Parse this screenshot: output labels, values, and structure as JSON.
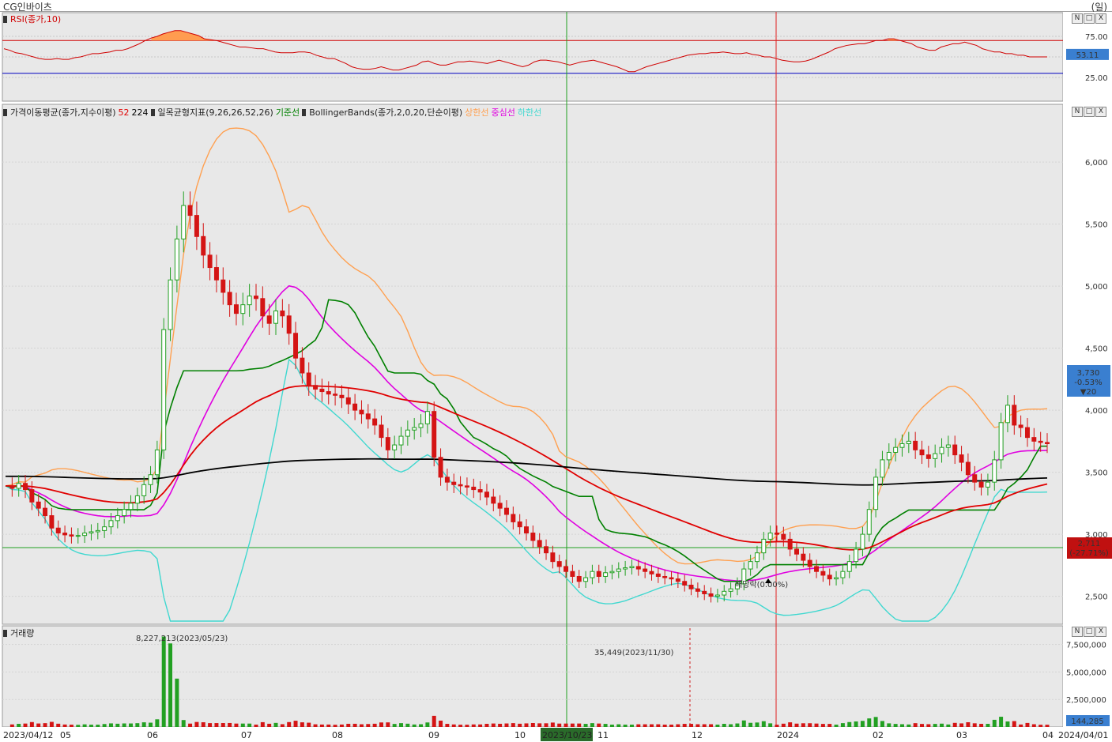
{
  "window": {
    "title": "CG인바이츠",
    "unit": "(일)"
  },
  "legends": {
    "rsi": "RSI(종가,10)",
    "ma_label": "가격이동평균(종가,지수이평)",
    "ma_periods": [
      "52",
      "224"
    ],
    "ichimoku_label": "일목균형지표(9,26,26,52,26)",
    "ichimoku_line": "기준선",
    "bb_label": "BollingerBands(종가,2,0,20,단순이평)",
    "bb_lines": [
      "상한선",
      "중심선",
      "하한선"
    ],
    "volume": "거래량"
  },
  "panel_buttons": [
    "N",
    "□",
    "X"
  ],
  "colors": {
    "up": "#22a022",
    "down": "#d41414",
    "ma52": "#e00000",
    "ma224": "#000000",
    "kijun": "#008000",
    "bb_upper": "#ffa050",
    "bb_mid": "#e000e0",
    "bb_lower": "#40d8d0",
    "rsi": "#d00000",
    "panel_bg": "#e8e8e8"
  },
  "chart_data": {
    "type": "candlestick",
    "rsi": {
      "yticks": [
        "75.00",
        "25.00"
      ],
      "last_value": "53.11",
      "upper_line": 70,
      "lower_line": 30,
      "values": [
        60,
        58,
        55,
        54,
        52,
        50,
        48,
        47,
        47,
        48,
        47,
        47,
        49,
        50,
        52,
        54,
        54,
        55,
        56,
        58,
        58,
        60,
        63,
        66,
        70,
        73,
        75,
        78,
        80,
        82,
        82,
        80,
        78,
        76,
        72,
        71,
        70,
        68,
        66,
        64,
        62,
        62,
        61,
        60,
        60,
        58,
        56,
        55,
        55,
        55,
        56,
        56,
        55,
        52,
        50,
        48,
        48,
        45,
        42,
        38,
        36,
        35,
        35,
        36,
        38,
        36,
        34,
        34,
        36,
        38,
        40,
        44,
        45,
        42,
        40,
        40,
        42,
        44,
        44,
        45,
        44,
        43,
        42,
        44,
        46,
        44,
        42,
        40,
        38,
        40,
        44,
        46,
        46,
        45,
        44,
        42,
        40,
        42,
        44,
        45,
        46,
        44,
        42,
        40,
        38,
        35,
        32,
        32,
        35,
        38,
        40,
        42,
        44,
        46,
        48,
        50,
        52,
        53,
        54,
        54,
        55,
        55,
        56,
        55,
        54,
        54,
        55,
        53,
        52,
        50,
        50,
        48,
        46,
        45,
        44,
        44,
        45,
        47,
        50,
        53,
        56,
        60,
        62,
        64,
        65,
        66,
        66,
        68,
        70,
        70,
        72,
        72,
        70,
        68,
        66,
        62,
        60,
        58,
        58,
        62,
        64,
        66,
        66,
        68,
        66,
        64,
        60,
        58,
        56,
        56,
        54,
        54,
        52,
        52,
        50,
        50,
        50,
        50
      ],
      "yrange": [
        0,
        100
      ]
    },
    "price": {
      "yticks": [
        "6,000",
        "5,500",
        "5,000",
        "4,500",
        "4,000",
        "3,500",
        "3,000",
        "2,500"
      ],
      "yrange": [
        2300,
        6300
      ],
      "current_price": "3,730",
      "current_change": "-0.53%",
      "current_diff": "▼20",
      "reference_price": "2,711",
      "reference_change": "(-27.71%)",
      "annotation": "배당락(0.00%)",
      "closes": [
        3390,
        3370,
        3410,
        3360,
        3260,
        3210,
        3150,
        3050,
        3010,
        2995,
        2985,
        2990,
        3010,
        3020,
        3030,
        3060,
        3110,
        3150,
        3200,
        3250,
        3310,
        3400,
        3480,
        3680,
        4650,
        5050,
        5380,
        5650,
        5570,
        5400,
        5250,
        5150,
        5050,
        4950,
        4850,
        4780,
        4850,
        4920,
        4900,
        4760,
        4700,
        4800,
        4760,
        4620,
        4420,
        4300,
        4200,
        4170,
        4150,
        4130,
        4120,
        4100,
        4050,
        4000,
        3970,
        3930,
        3880,
        3780,
        3680,
        3720,
        3790,
        3840,
        3860,
        3890,
        3990,
        3620,
        3460,
        3420,
        3400,
        3390,
        3380,
        3360,
        3340,
        3300,
        3250,
        3210,
        3160,
        3100,
        3060,
        3010,
        2950,
        2900,
        2850,
        2780,
        2740,
        2700,
        2660,
        2620,
        2650,
        2700,
        2660,
        2690,
        2700,
        2720,
        2730,
        2740,
        2720,
        2700,
        2680,
        2660,
        2650,
        2640,
        2620,
        2590,
        2560,
        2540,
        2520,
        2500,
        2510,
        2540,
        2560,
        2600,
        2720,
        2780,
        2850,
        2960,
        3010,
        3000,
        2960,
        2880,
        2840,
        2790,
        2740,
        2700,
        2670,
        2640,
        2650,
        2700,
        2780,
        2880,
        3000,
        3200,
        3460,
        3600,
        3660,
        3700,
        3730,
        3750,
        3680,
        3640,
        3610,
        3650,
        3700,
        3720,
        3640,
        3580,
        3480,
        3420,
        3380,
        3420,
        3600,
        3900,
        4040,
        3880,
        3860,
        3780,
        3750,
        3740,
        3730
      ]
    },
    "volume": {
      "yticks": [
        "7,500,000",
        "5,000,000",
        "2,500,000"
      ],
      "yrange": [
        0,
        9200000
      ],
      "max_label": "8,227,213(2023/05/23)",
      "min_label": "35,449(2023/11/30)",
      "last_value": "144,285"
    },
    "x_labels": [
      "2023/04/12",
      "05",
      "06",
      "07",
      "08",
      "09",
      "10",
      "2023/10/23",
      "11",
      "12",
      "2024",
      "02",
      "03",
      "04",
      "2024/04/01"
    ]
  }
}
